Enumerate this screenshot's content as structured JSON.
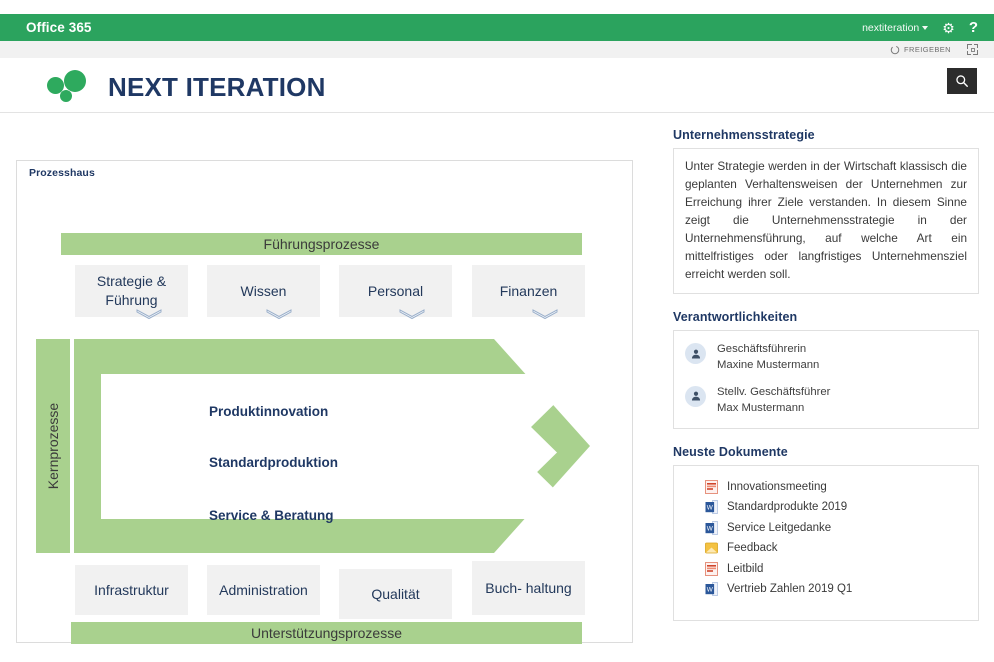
{
  "suite_bar": {
    "brand": "Office 365",
    "tenant": "nextiteration",
    "settings_icon": "gear-icon",
    "help_icon": "help-icon",
    "help_label": "?"
  },
  "command_bar": {
    "share_label": "FREIGEBEN",
    "share_icon": "share-icon",
    "focus_icon": "focus-mode-icon"
  },
  "site_header": {
    "title": "NEXT ITERATION",
    "logo_icon": "three-dots-logo",
    "search_icon": "search-icon"
  },
  "process_house": {
    "title": "Prozesshaus",
    "management_band": "Führungsprozesse",
    "management_boxes": [
      {
        "label": "Strategie & Führung"
      },
      {
        "label": "Wissen"
      },
      {
        "label": "Personal"
      },
      {
        "label": "Finanzen"
      }
    ],
    "core_label": "Kernprozesse",
    "core_rows": [
      {
        "label": "Produktinnovation"
      },
      {
        "label": "Standardproduktion"
      },
      {
        "label": "Service & Beratung"
      }
    ],
    "support_boxes": [
      {
        "label": "Infrastruktur"
      },
      {
        "label": "Administration"
      },
      {
        "label": "Qualität"
      },
      {
        "label": "Buch- haltung"
      }
    ],
    "support_band": "Unterstützungsprozesse",
    "chevron_icon": "chevron-down-icon"
  },
  "strategy": {
    "title": "Unternehmensstrategie",
    "body": "Unter Strategie werden in der Wirtschaft klassisch die geplanten Verhaltensweisen der Unternehmen zur Erreichung ihrer Ziele verstanden. In diesem Sinne zeigt die Unternehmensstrategie in der Unternehmensführung, auf welche Art ein mittelfristiges oder langfristiges Unternehmensziel erreicht werden soll."
  },
  "responsibilities": {
    "title": "Verantwortlichkeiten",
    "people": [
      {
        "role": "Geschäftsführerin",
        "name": "Maxine Mustermann",
        "avatar_icon": "person-icon"
      },
      {
        "role": "Stellv. Geschäftsführer",
        "name": "Max Mustermann",
        "avatar_icon": "person-icon"
      }
    ]
  },
  "documents": {
    "title": "Neuste Dokumente",
    "items": [
      {
        "name": "Innovationsmeeting",
        "icon": "powerpoint-file-icon"
      },
      {
        "name": "Standardprodukte 2019",
        "icon": "word-file-icon"
      },
      {
        "name": "Service Leitgedanke",
        "icon": "word-file-icon"
      },
      {
        "name": "Feedback",
        "icon": "onenote-file-icon"
      },
      {
        "name": "Leitbild",
        "icon": "powerpoint-file-icon"
      },
      {
        "name": "Vertrieb  Zahlen 2019 Q1",
        "icon": "word-file-icon"
      }
    ]
  },
  "colors": {
    "suite_green": "#2BA35E",
    "brand_green": "#2EAA5E",
    "process_green": "#A9D18E",
    "navy": "#1F3864",
    "box_gray": "#F1F1F1"
  }
}
